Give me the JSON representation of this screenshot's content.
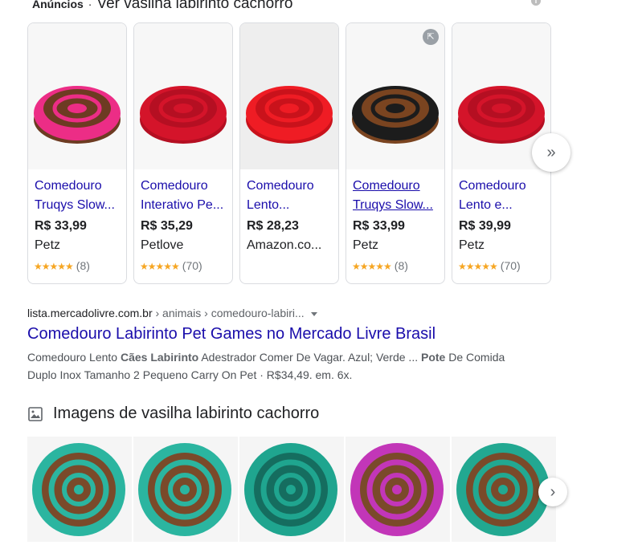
{
  "ads": {
    "label": "Anúncios",
    "separator": "·",
    "title": "Ver vasilha labirinto cachorro",
    "info_icon": "info-icon",
    "products": [
      {
        "title_line1": "Comedouro",
        "title_line2": "Truqys Slow...",
        "price": "R$ 33,99",
        "store": "Petz",
        "stars": "★★★★★",
        "count": "(8)",
        "color": "#ec2d86",
        "inner": "#6d3b22",
        "bg": "#f7f7f7"
      },
      {
        "title_line1": "Comedouro",
        "title_line2": "Interativo Pe...",
        "price": "R$ 35,29",
        "store": "Petlove",
        "stars": "★★★★★",
        "count": "(70)",
        "color": "#d4142a",
        "inner": "#b50f22",
        "bg": "#f7f7f7"
      },
      {
        "title_line1": "Comedouro",
        "title_line2": "Lento...",
        "price": "R$ 28,23",
        "store": "Amazon.co...",
        "stars": "",
        "count": "",
        "color": "#ef1c24",
        "inner": "#c9121b",
        "bg": "#eeeeee"
      },
      {
        "title_line1": "Comedouro",
        "title_line2": "Truqys Slow...",
        "price": "R$ 33,99",
        "store": "Petz",
        "stars": "★★★★★",
        "count": "(8)",
        "color": "#1c1c1c",
        "inner": "#7a4420",
        "bg": "#f7f7f7"
      },
      {
        "title_line1": "Comedouro",
        "title_line2": "Lento e...",
        "price": "R$ 39,99",
        "store": "Petz",
        "stars": "★★★★★",
        "count": "(70)",
        "color": "#d4142a",
        "inner": "#b50f22",
        "bg": "#f7f7f7"
      }
    ],
    "external_icon": "external-link-icon",
    "next_icon": "double-chevron-right-icon",
    "next_glyph": "»"
  },
  "result": {
    "domain": "lista.mercadolivre.com.br",
    "path": " › animais › comedouro-labiri...",
    "title": "Comedouro Labirinto Pet Games no Mercado Livre Brasil",
    "snippet_1a": "Comedouro Lento ",
    "snippet_1b": "Cães Labirinto",
    "snippet_1c": " Adestrador Comer De Vagar. Azul; Verde ... ",
    "snippet_1d": "Pote",
    "snippet_1e": " De Comida",
    "snippet_2": "Duplo Inox Tamanho 2 Pequeno Carry On Pet · R$34,49. em. 6x."
  },
  "images": {
    "heading": "Imagens de vasilha labirinto cachorro",
    "heading_icon": "image-icon",
    "next_glyph": "›",
    "thumbs": [
      {
        "color": "#2bb5a0",
        "inner": "#7a4a2a"
      },
      {
        "color": "#2bb5a0",
        "inner": "#7a4a2a"
      },
      {
        "color": "#1fa58f",
        "inner": "#156d5f"
      },
      {
        "color": "#c236b8",
        "inner": "#7a4a2a"
      },
      {
        "color": "#22a891",
        "inner": "#7a4a2a"
      }
    ]
  }
}
